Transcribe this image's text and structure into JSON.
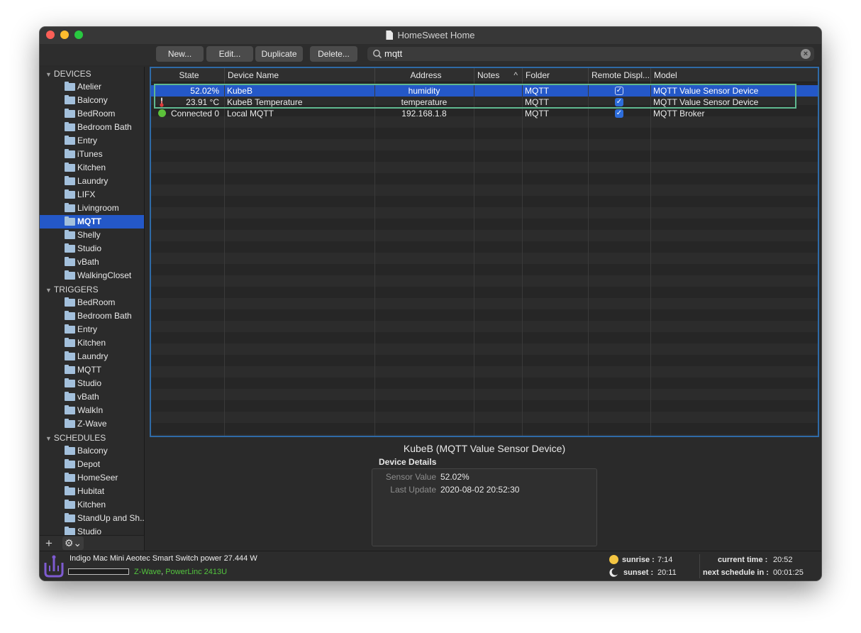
{
  "window": {
    "title": "HomeSweet Home"
  },
  "toolbar": {
    "new_label": "New...",
    "edit_label": "Edit...",
    "duplicate_label": "Duplicate",
    "delete_label": "Delete...",
    "search_value": "mqtt"
  },
  "sidebar": {
    "devices_header": "DEVICES",
    "devices": [
      "Atelier",
      "Balcony",
      "BedRoom",
      "Bedroom Bath",
      "Entry",
      "iTunes",
      "Kitchen",
      "Laundry",
      "LIFX",
      "Livingroom",
      "MQTT",
      "Shelly",
      "Studio",
      "vBath",
      "WalkingCloset"
    ],
    "selected_device_folder": "MQTT",
    "triggers_header": "TRIGGERS",
    "triggers": [
      "BedRoom",
      "Bedroom Bath",
      "Entry",
      "Kitchen",
      "Laundry",
      "MQTT",
      "Studio",
      "vBath",
      "WalkIn",
      "Z-Wave"
    ],
    "schedules_header": "SCHEDULES",
    "schedules": [
      "Balcony",
      "Depot",
      "HomeSeer",
      "Hubitat",
      "Kitchen",
      "StandUp and Sh...",
      "Studio"
    ],
    "add_label": "+",
    "gear_label": "⚙⌄"
  },
  "table": {
    "columns": [
      "State",
      "Device Name",
      "Address",
      "Notes",
      "Folder",
      "Remote Displ...",
      "Model"
    ],
    "sort_indicator": "^",
    "rows": [
      {
        "state": "52.02%",
        "name": "KubeB",
        "address": "humidity",
        "notes": "",
        "folder": "MQTT",
        "remote": "✓",
        "model": "MQTT Value Sensor Device",
        "icon": "none"
      },
      {
        "state": "23.91 °C",
        "name": "KubeB Temperature",
        "address": "temperature",
        "notes": "",
        "folder": "MQTT",
        "remote": "✓",
        "model": "MQTT Value Sensor Device",
        "icon": "thermometer-icon"
      },
      {
        "state": "Connected 0",
        "name": "Local MQTT",
        "address": "192.168.1.8",
        "notes": "",
        "folder": "MQTT",
        "remote": "✓",
        "model": "MQTT Broker",
        "icon": "green-status-icon"
      }
    ]
  },
  "detail": {
    "title": "KubeB (MQTT Value Sensor Device)",
    "section": "Device Details",
    "sensor_value_label": "Sensor Value",
    "sensor_value": "52.02%",
    "last_update_label": "Last Update",
    "last_update": "2020-08-02 20:52:30"
  },
  "status": {
    "message": "Indigo Mac Mini Aeotec Smart Switch power 27.444 W",
    "interface_zwave": "Z-Wave",
    "interface_sep": ",",
    "interface_powerlinc": "PowerLinc 2413U",
    "sunrise_label": "sunrise :",
    "sunrise": "7:14",
    "sunset_label": "sunset :",
    "sunset": "20:11",
    "current_time_label": "current time :",
    "current_time": "20:52",
    "next_schedule_label": "next schedule in :",
    "next_schedule": "00:01:25"
  },
  "colors": {
    "selection": "#2458c8",
    "table_border": "#2f6aa6",
    "highlight_box": "#5fb890",
    "interface_green": "#53c53e"
  }
}
